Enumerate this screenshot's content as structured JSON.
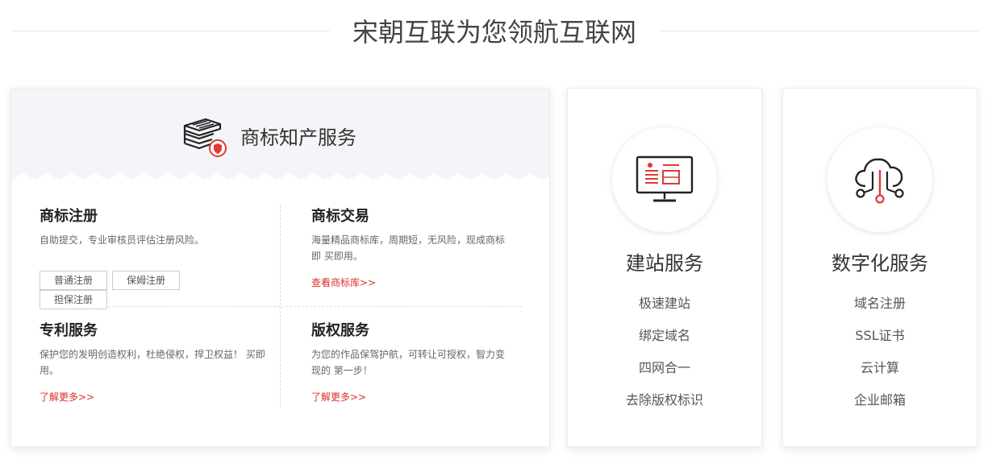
{
  "header": {
    "title": "宋朝互联为您领航互联网"
  },
  "ip": {
    "title": "商标知产服务",
    "icon": "books-shield-icon",
    "accent": "#e03a35",
    "services": [
      {
        "title": "商标注册",
        "desc": "自助提交，专业审核员评估注册风险。",
        "buttons": [
          "普通注册",
          "保姆注册",
          "担保注册"
        ]
      },
      {
        "title": "商标交易",
        "desc": "海量精品商标库，周期短，无风险，现成商标即 买即用。",
        "link": "查看商标库>>"
      },
      {
        "title": "专利服务",
        "desc": "保护您的发明创造权利，杜绝侵权，捍卫权益！ 买即用。",
        "link": "了解更多>>"
      },
      {
        "title": "版权服务",
        "desc": "为您的作品保驾护航，可转让可授权，智力变现的 第一步！",
        "link": "了解更多>>"
      }
    ]
  },
  "website": {
    "title": "建站服务",
    "icon": "monitor-icon",
    "items": [
      "极速建站",
      "绑定域名",
      "四网合一",
      "去除版权标识"
    ]
  },
  "digital": {
    "title": "数字化服务",
    "icon": "cloud-network-icon",
    "items": [
      "域名注册",
      "SSL证书",
      "云计算",
      "企业邮箱"
    ]
  },
  "colors": {
    "accent": "#e03a35",
    "link": "#d9302a",
    "head_bg": "#f4f5f8"
  }
}
